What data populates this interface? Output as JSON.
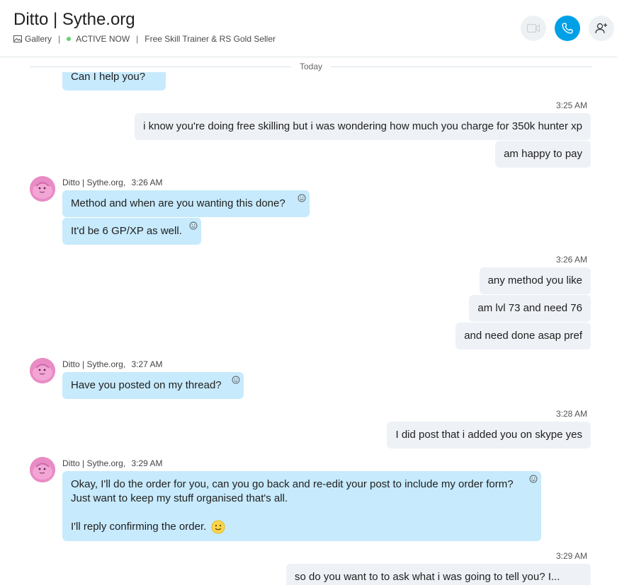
{
  "header": {
    "title": "Ditto | Sythe.org",
    "gallery_label": "Gallery",
    "status_label": "ACTIVE NOW",
    "mood": "Free Skill Trainer & RS Gold Seller"
  },
  "colors": {
    "accent": "#00a0e6",
    "incoming_bubble": "#c7eafc",
    "outgoing_bubble": "#eef1f6",
    "online": "#5fd36b",
    "avatar": "#e98bc5"
  },
  "chat": {
    "day_separator": "Today",
    "msg0": {
      "text": "Can I help you?"
    },
    "group1": {
      "time": "3:25 AM",
      "msg1": "i know you're doing free skilling but i was wondering how much you charge for 350k hunter xp",
      "msg2": "am happy to pay"
    },
    "group2": {
      "sender": "Ditto | Sythe.org,",
      "time": "3:26 AM",
      "msg1": "Method and when are you wanting this done?",
      "msg2": "It'd be 6 GP/XP as well."
    },
    "group3": {
      "time": "3:26 AM",
      "msg1": "any method you like",
      "msg2": "am lvl 73 and need 76",
      "msg3": "and need done asap pref"
    },
    "group4": {
      "sender": "Ditto | Sythe.org,",
      "time": "3:27 AM",
      "msg1": "Have you posted on my thread?"
    },
    "group5": {
      "time": "3:28 AM",
      "msg1": "I did post that i added you on skype yes"
    },
    "group6": {
      "sender": "Ditto | Sythe.org,",
      "time": "3:29 AM",
      "line1": "Okay, I'll do the order for you, can you go back and re-edit your post to include my order form?",
      "line2": "Just want to keep my stuff organised that's all.",
      "line3": "I'll reply confirming the order."
    },
    "group7": {
      "time": "3:29 AM",
      "msg1": "so do you want to to ask what i was going to tell you? I..."
    }
  }
}
